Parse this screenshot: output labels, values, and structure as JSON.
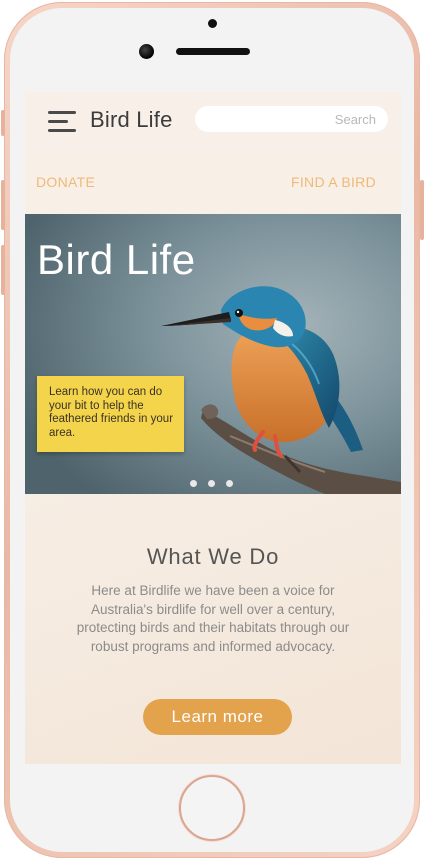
{
  "app": {
    "title": "Bird Life"
  },
  "header": {
    "menu_icon": "hamburger-menu-icon",
    "brand": "Bird Life",
    "search": {
      "placeholder": "Search",
      "value": ""
    }
  },
  "nav": {
    "donate": "DONATE",
    "find_bird": "FIND A BIRD"
  },
  "hero": {
    "title": "Bird Life",
    "card_text": "Learn how you can do your bit to help the feathered friends in your area.",
    "image_subject": "kingfisher perched on branch",
    "carousel_dots": 3
  },
  "about": {
    "heading": "What We Do",
    "body": "Here at Birdlife we have been a voice for Australia's birdlife for well over a century, protecting birds and their habitats through our robust programs and informed advocacy.",
    "cta": "Learn more"
  },
  "colors": {
    "accent_orange": "#e3a24c",
    "nav_link": "#f1b978",
    "card_yellow": "#f4d44a",
    "phone_frame": "#e9b8a4"
  }
}
